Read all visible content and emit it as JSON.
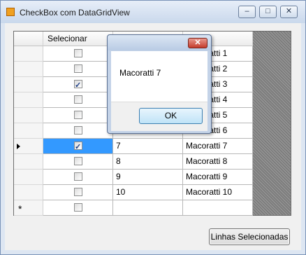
{
  "window": {
    "title": "CheckBox com DataGridView",
    "controls": [
      "minimize-icon",
      "maximize-icon",
      "close-icon"
    ]
  },
  "grid": {
    "columns": [
      "Selecionar",
      "",
      ""
    ],
    "rows": [
      {
        "checked": false,
        "id": "",
        "name": "Macoratti 1"
      },
      {
        "checked": false,
        "id": "",
        "name": "Macoratti 2"
      },
      {
        "checked": true,
        "id": "",
        "name": "Macoratti 3"
      },
      {
        "checked": false,
        "id": "",
        "name": "Macoratti 4"
      },
      {
        "checked": false,
        "id": "",
        "name": "Macoratti 5"
      },
      {
        "checked": false,
        "id": "",
        "name": "Macoratti 6"
      },
      {
        "checked": true,
        "id": "7",
        "name": "Macoratti 7",
        "current": true
      },
      {
        "checked": false,
        "id": "8",
        "name": "Macoratti 8"
      },
      {
        "checked": false,
        "id": "9",
        "name": "Macoratti 9"
      },
      {
        "checked": false,
        "id": "10",
        "name": "Macoratti 10"
      }
    ],
    "new_row_marker": "*"
  },
  "button_label": "Linhas Selecionadas",
  "dialog": {
    "message": "Macoratti 7",
    "ok_label": "OK"
  },
  "colors": {
    "selected_cell": "#3399ff",
    "window_frame": "#dde6f2"
  }
}
